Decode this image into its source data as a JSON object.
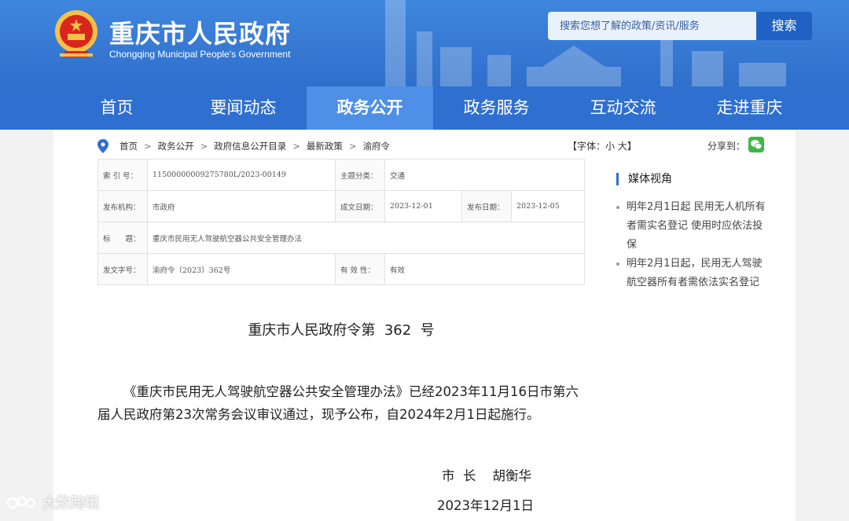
{
  "header": {
    "site_title": "重庆市人民政府",
    "site_subtitle": "Chongqing Municipal People's Government",
    "search_placeholder": "搜索您想了解的政策/资讯/服务",
    "search_button": "搜索"
  },
  "nav": {
    "items": [
      "首页",
      "要闻动态",
      "政务公开",
      "政务服务",
      "互动交流",
      "走进重庆"
    ],
    "active": "政务公开"
  },
  "breadcrumb": {
    "items": [
      "首页",
      "政务公开",
      "政府信息公开目录",
      "最新政策",
      "渝府令"
    ],
    "separator": ">"
  },
  "tools": {
    "font_size_label": "【字体：小 大】",
    "share_label": "分享到："
  },
  "meta": {
    "index_label": "索 引 号：",
    "index_value": "11500000009275780L/2023-00149",
    "category_label": "主题分类：",
    "category_value": "交通",
    "issuer_label": "发布机构：",
    "issuer_value": "市政府",
    "written_date_label": "成文日期：",
    "written_date_value": "2023-12-01",
    "publish_date_label": "发布日期：",
    "publish_date_value": "2023-12-05",
    "title_label": "标　　题：",
    "title_value": "重庆市民用无人驾驶航空器公共安全管理办法",
    "doc_no_label": "发文字号：",
    "doc_no_value": "渝府令〔2023〕362号",
    "validity_label": "有 效 性：",
    "validity_value": "有效"
  },
  "document": {
    "heading": "重庆市人民政府令第  362  号",
    "body": "《重庆市民用无人驾驶航空器公共安全管理办法》已经2023年11月16日市第六届人民政府第23次常务会议审议通过，现予公布，自2024年2月1日起施行。",
    "signature": "市  长    胡衡华",
    "date": "2023年12月1日"
  },
  "sidebar": {
    "title": "媒体视角",
    "items": [
      "明年2月1日起 民用无人机所有者需实名登记 使用时应依法投保",
      "明年2月1日起，民用无人驾驶航空器所有者需依法实名登记"
    ]
  },
  "watermark": {
    "text": "大数跨境"
  }
}
